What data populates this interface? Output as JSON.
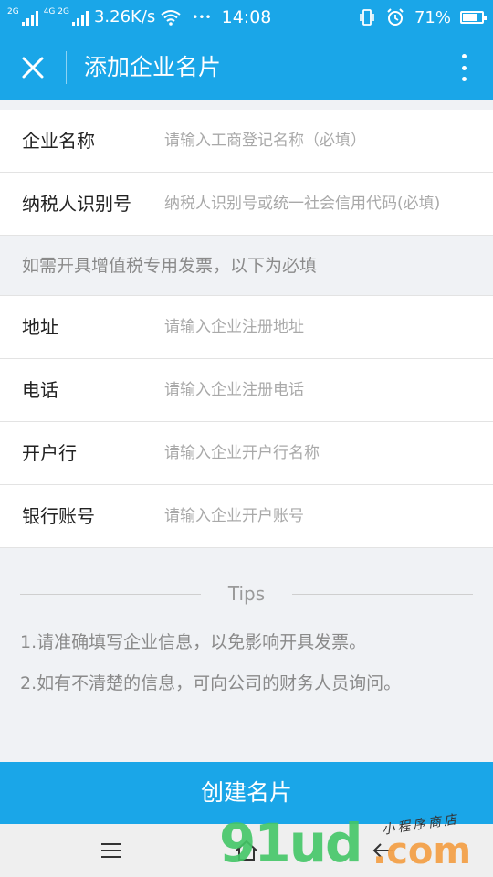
{
  "status_bar": {
    "sig1_tag": "2G",
    "sig2_tag": "4G 2G",
    "speed": "3.26K/s",
    "more": "•••",
    "time": "14:08",
    "battery_pct": "71%",
    "battery_level": 0.71
  },
  "header": {
    "title": "添加企业名片"
  },
  "form": {
    "company_name": {
      "label": "企业名称",
      "placeholder": "请输入工商登记名称（必填）"
    },
    "tax_id": {
      "label": "纳税人识别号",
      "placeholder": "纳税人识别号或统一社会信用代码(必填)"
    },
    "vat_note": "如需开具增值税专用发票，以下为必填",
    "address": {
      "label": "地址",
      "placeholder": "请输入企业注册地址"
    },
    "phone": {
      "label": "电话",
      "placeholder": "请输入企业注册电话"
    },
    "bank": {
      "label": "开户行",
      "placeholder": "请输入企业开户行名称"
    },
    "account": {
      "label": "银行账号",
      "placeholder": "请输入企业开户账号"
    }
  },
  "tips": {
    "title": "Tips",
    "items": [
      "1.请准确填写企业信息，以免影响开具发票。",
      "2.如有不清楚的信息，可向公司的财务人员询问。"
    ]
  },
  "create_button": "创建名片",
  "watermark": {
    "main": "91ud",
    "suffix": ".com",
    "tagline": "小程序商店"
  },
  "colors": {
    "accent": "#1aa6e8",
    "background": "#f0f2f5"
  }
}
